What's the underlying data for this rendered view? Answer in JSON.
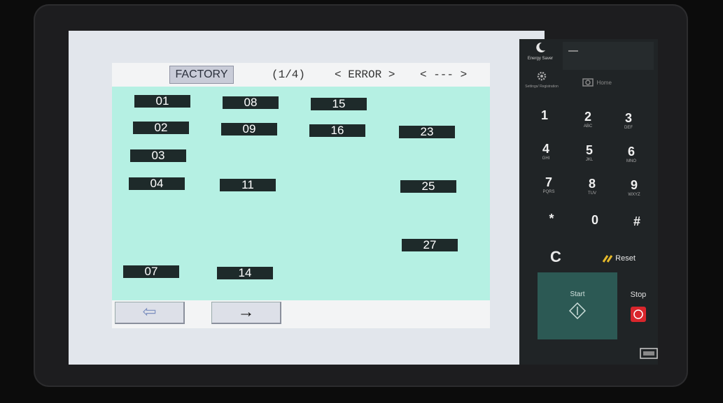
{
  "header": {
    "factory_label": "FACTORY",
    "page_indicator": "(1/4)",
    "error_nav": "< ERROR >",
    "sub_nav": "< --- >"
  },
  "cells": [
    "01",
    "02",
    "03",
    "04",
    "07",
    "08",
    "09",
    "11",
    "14",
    "15",
    "16",
    "23",
    "25",
    "27"
  ],
  "nav": {
    "prev_symbol": "⇦",
    "next_symbol": "→"
  },
  "side_panel": {
    "energy_saver_label": "Energy Saver",
    "settings_label": "Settings/ Registration",
    "home_label": "Home",
    "keys": [
      {
        "num": "1",
        "sub": ""
      },
      {
        "num": "2",
        "sub": "ABC"
      },
      {
        "num": "3",
        "sub": "DEF"
      },
      {
        "num": "4",
        "sub": "GHI"
      },
      {
        "num": "5",
        "sub": "JKL"
      },
      {
        "num": "6",
        "sub": "MNO"
      },
      {
        "num": "7",
        "sub": "PQRS"
      },
      {
        "num": "8",
        "sub": "TUV"
      },
      {
        "num": "9",
        "sub": "WXYZ"
      },
      {
        "num": "*",
        "sub": ""
      },
      {
        "num": "0",
        "sub": ""
      },
      {
        "num": "#",
        "sub": ""
      }
    ],
    "clear_label": "C",
    "reset_label": "Reset",
    "start_label": "Start",
    "stop_label": "Stop"
  },
  "colors": {
    "grid_bg": "#b5f0e3",
    "cell_bg": "#1e2a2a",
    "start_bg": "#2c5954",
    "stop_red": "#d9262c",
    "reset_yellow": "#e5b92a"
  }
}
